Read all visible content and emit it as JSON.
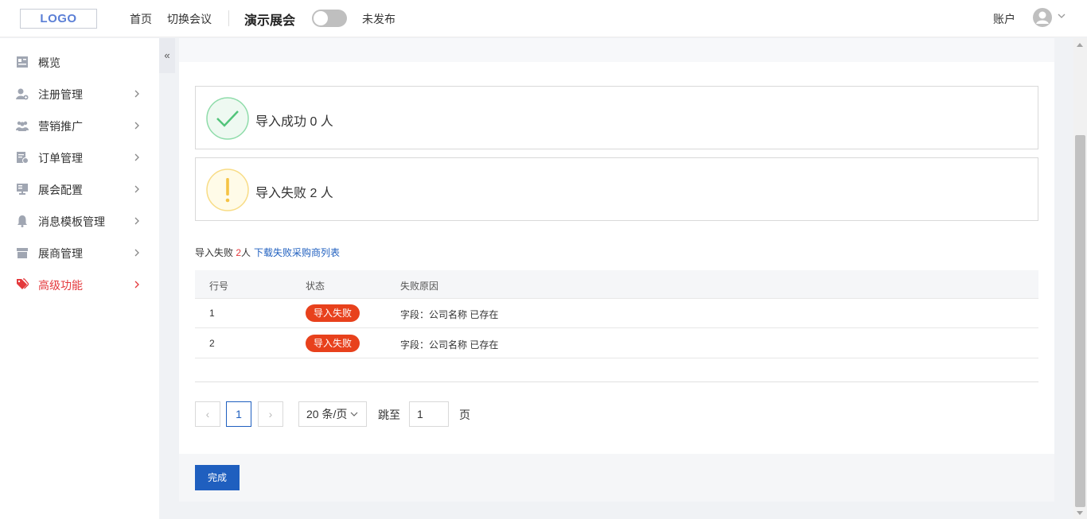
{
  "header": {
    "logo": "LOGO",
    "nav": [
      "首页",
      "切换会议"
    ],
    "event_title": "演示展会",
    "publish_status": "未发布",
    "account_label": "账户"
  },
  "sidebar": {
    "collapse_icon": "«",
    "items": [
      {
        "label": "概览",
        "icon": "overview-icon",
        "has_arrow": false
      },
      {
        "label": "注册管理",
        "icon": "user-register-icon",
        "has_arrow": true
      },
      {
        "label": "营销推广",
        "icon": "group-icon",
        "has_arrow": true
      },
      {
        "label": "订单管理",
        "icon": "order-icon",
        "has_arrow": true
      },
      {
        "label": "展会配置",
        "icon": "monitor-icon",
        "has_arrow": true
      },
      {
        "label": "消息模板管理",
        "icon": "bell-icon",
        "has_arrow": true
      },
      {
        "label": "展商管理",
        "icon": "store-icon",
        "has_arrow": true
      },
      {
        "label": "高级功能",
        "icon": "tags-icon",
        "has_arrow": true,
        "active": true
      }
    ]
  },
  "import_result": {
    "success_text": "导入成功 0 人",
    "fail_text": "导入失败 2 人"
  },
  "fail_summary": {
    "prefix": "导入失败 ",
    "count": "2",
    "suffix": "人",
    "download_link": "下载失败采购商列表"
  },
  "table": {
    "headers": [
      "行号",
      "状态",
      "失败原因"
    ],
    "rows": [
      {
        "row": "1",
        "status": "导入失败",
        "reason": "字段：公司名称 已存在"
      },
      {
        "row": "2",
        "status": "导入失败",
        "reason": "字段：公司名称 已存在"
      }
    ]
  },
  "pagination": {
    "prev": "‹",
    "current_page": "1",
    "next": "›",
    "page_size": "20 条/页",
    "jump_label": "跳至",
    "jump_value": "1",
    "page_suffix": "页"
  },
  "footer": {
    "done_label": "完成"
  },
  "colors": {
    "accent": "#1f5fbf",
    "danger": "#e4393c",
    "badge": "#e8411c",
    "success": "#52c47a",
    "warning": "#f5c344"
  }
}
